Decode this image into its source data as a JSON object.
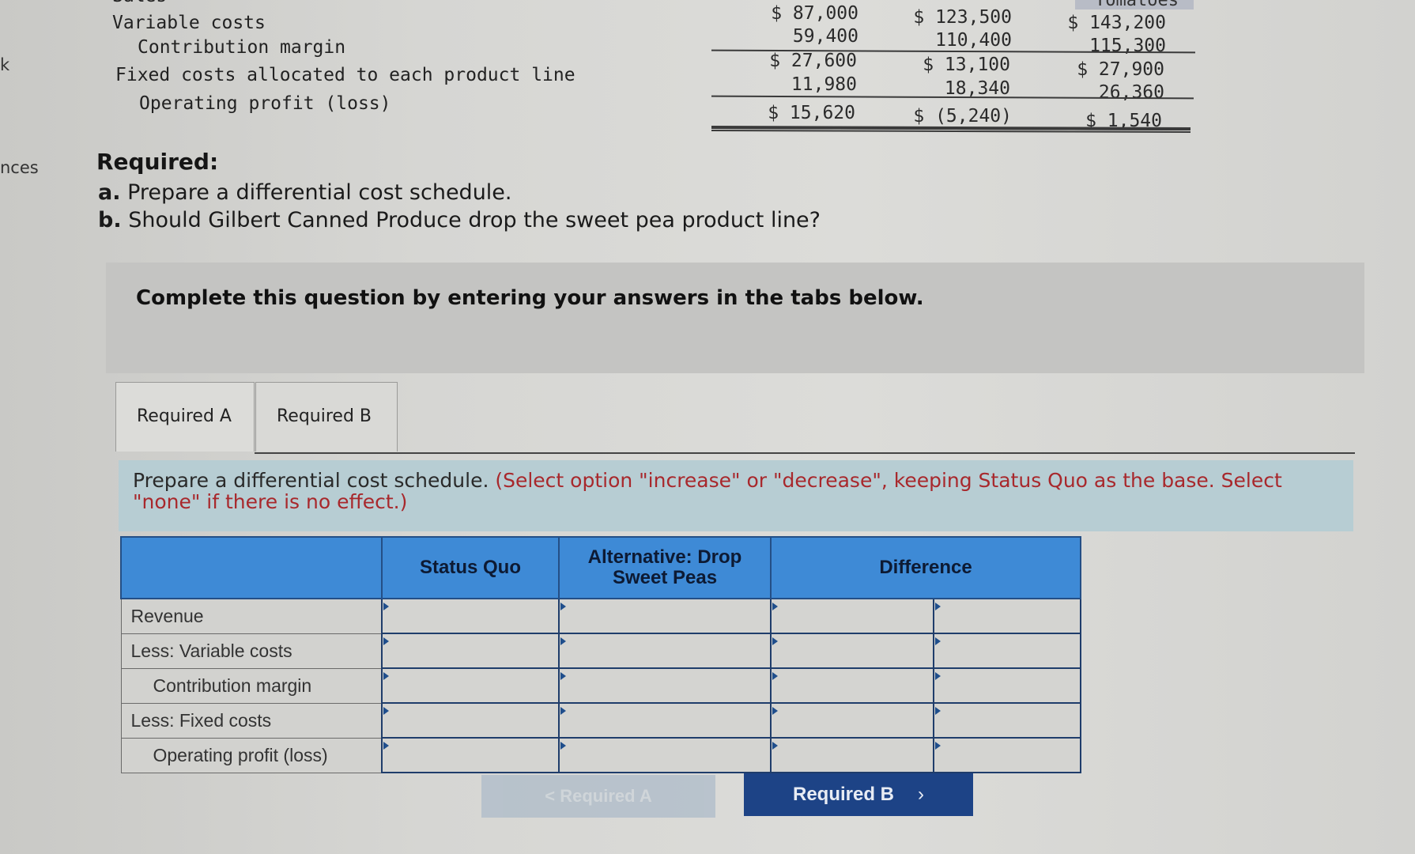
{
  "statement": {
    "rows": [
      {
        "label": "Sales",
        "values": [
          "$ 87,000",
          "$ 123,500",
          "$ 143,200"
        ]
      },
      {
        "label": "Variable costs",
        "values": [
          "59,400",
          "110,400",
          "115,300"
        ]
      },
      {
        "label": "Contribution margin",
        "values": [
          "$ 27,600",
          "$ 13,100",
          "$ 27,900"
        ]
      },
      {
        "label": "Fixed costs allocated to each product line",
        "values": [
          "11,980",
          "18,340",
          "26,360"
        ]
      },
      {
        "label": "Operating profit (loss)",
        "values": [
          "$ 15,620",
          "$ (5,240)",
          "$ 1,540"
        ]
      }
    ],
    "column_headers": [
      "",
      "",
      "Tomatoes"
    ]
  },
  "sidebar": {
    "fragment_k": "k",
    "fragment_nces": "nces"
  },
  "required": {
    "title": "Required:",
    "a_prefix": "a.",
    "a_text": "Prepare a differential cost schedule.",
    "b_prefix": "b.",
    "b_text": "Should Gilbert Canned Produce drop the sweet pea product line?"
  },
  "instruction": "Complete this question by entering your answers in the tabs below.",
  "tabs": [
    {
      "label": "Required A",
      "active": true
    },
    {
      "label": "Required B",
      "active": false
    }
  ],
  "prompt": {
    "main": "Prepare a differential cost schedule. ",
    "note": "(Select option \"increase\" or \"decrease\", keeping Status Quo as the base. Select \"none\" if there is no effect.)"
  },
  "schedule": {
    "headers": [
      "",
      "Status Quo",
      "Alternative: Drop Sweet Peas",
      "Difference",
      ""
    ],
    "rows": [
      {
        "label": "Revenue",
        "status_quo": "",
        "alternative": "",
        "difference": "",
        "direction": ""
      },
      {
        "label": "Less: Variable costs",
        "status_quo": "",
        "alternative": "",
        "difference": "",
        "direction": ""
      },
      {
        "label": "Contribution margin",
        "status_quo": "",
        "alternative": "",
        "difference": "",
        "direction": ""
      },
      {
        "label": "Less: Fixed costs",
        "status_quo": "",
        "alternative": "",
        "difference": "",
        "direction": ""
      },
      {
        "label": "Operating profit (loss)",
        "status_quo": "",
        "alternative": "",
        "difference": "",
        "direction": ""
      }
    ]
  },
  "nav": {
    "prev_label": "< Required A",
    "next_label": "Required B",
    "next_icon": "chevron-right-icon"
  }
}
